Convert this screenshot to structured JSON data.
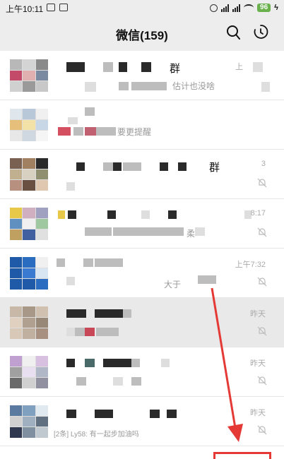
{
  "status": {
    "time": "上午10:11",
    "battery": "96"
  },
  "header": {
    "title": "微信(159)"
  },
  "chats": [
    {
      "name": "群",
      "preview": "估计也没啥",
      "time": "上",
      "muted": false,
      "selected": false,
      "avatar": [
        "#b8b8b8",
        "#d4d4d4",
        "#8a8a8a",
        "#c44a6a",
        "#e0b0b0",
        "#7a8aa0",
        "#d0d0d0",
        "#9a9a9a",
        "#c8c8c8"
      ]
    },
    {
      "name": "",
      "preview": "要更提醒",
      "time": "",
      "muted": false,
      "selected": false,
      "avatar": [
        "#dfe6ec",
        "#b9c8d8",
        "#f0f0f0",
        "#e6c07a",
        "#f3e2a8",
        "#c7d7e6",
        "#e8e8e8",
        "#cfd8e0",
        "#f5f5f5"
      ]
    },
    {
      "name": "群",
      "preview": "",
      "time": "3",
      "muted": true,
      "selected": false,
      "avatar": [
        "#7a6050",
        "#a08060",
        "#2a2a2a",
        "#c0b090",
        "#d8d0c0",
        "#909070",
        "#b89080",
        "#6a5040",
        "#e0c8b0"
      ]
    },
    {
      "name": "",
      "preview": "柔",
      "time": "8:17",
      "muted": true,
      "selected": false,
      "avatar": [
        "#e8c848",
        "#d0b0c0",
        "#a0a0c0",
        "#6090c0",
        "#f0f0f0",
        "#a0c8a0",
        "#c0a060",
        "#4060a0",
        "#e0e0e0"
      ]
    },
    {
      "name": "",
      "preview": "大于",
      "time": "上午7:32",
      "muted": true,
      "selected": false,
      "avatar": [
        "#1e5aa8",
        "#2a6cc0",
        "#f0f0f0",
        "#1e5aa8",
        "#3a7ad0",
        "#d8e6f4",
        "#1e5aa8",
        "#1e5aa8",
        "#2a6cc0"
      ]
    },
    {
      "name": "",
      "preview": "",
      "time": "昨天",
      "muted": true,
      "selected": true,
      "avatar": [
        "#c8b8a8",
        "#a89888",
        "#d0c0b0",
        "#e0d0c0",
        "#b0a090",
        "#988878",
        "#d8c8b8",
        "#c0b0a0",
        "#a89080"
      ]
    },
    {
      "name": "",
      "preview": "",
      "time": "昨天",
      "muted": true,
      "selected": false,
      "avatar": [
        "#c0a0d0",
        "#f0f0f0",
        "#d8c0e0",
        "#a0a0a0",
        "#e8e0f0",
        "#b0b8c8",
        "#6a6a6a",
        "#d0d0d0",
        "#9090a0"
      ]
    },
    {
      "name": "",
      "preview": "[2条] Ly58: 有一起步加油吗",
      "time": "昨天",
      "muted": true,
      "selected": false,
      "avatar": [
        "#5a7aa0",
        "#80a0c0",
        "#e0e8f0",
        "#d0d0d0",
        "#a0b0c0",
        "#607080",
        "#303850",
        "#8090a0",
        "#c0c8d0"
      ]
    }
  ]
}
